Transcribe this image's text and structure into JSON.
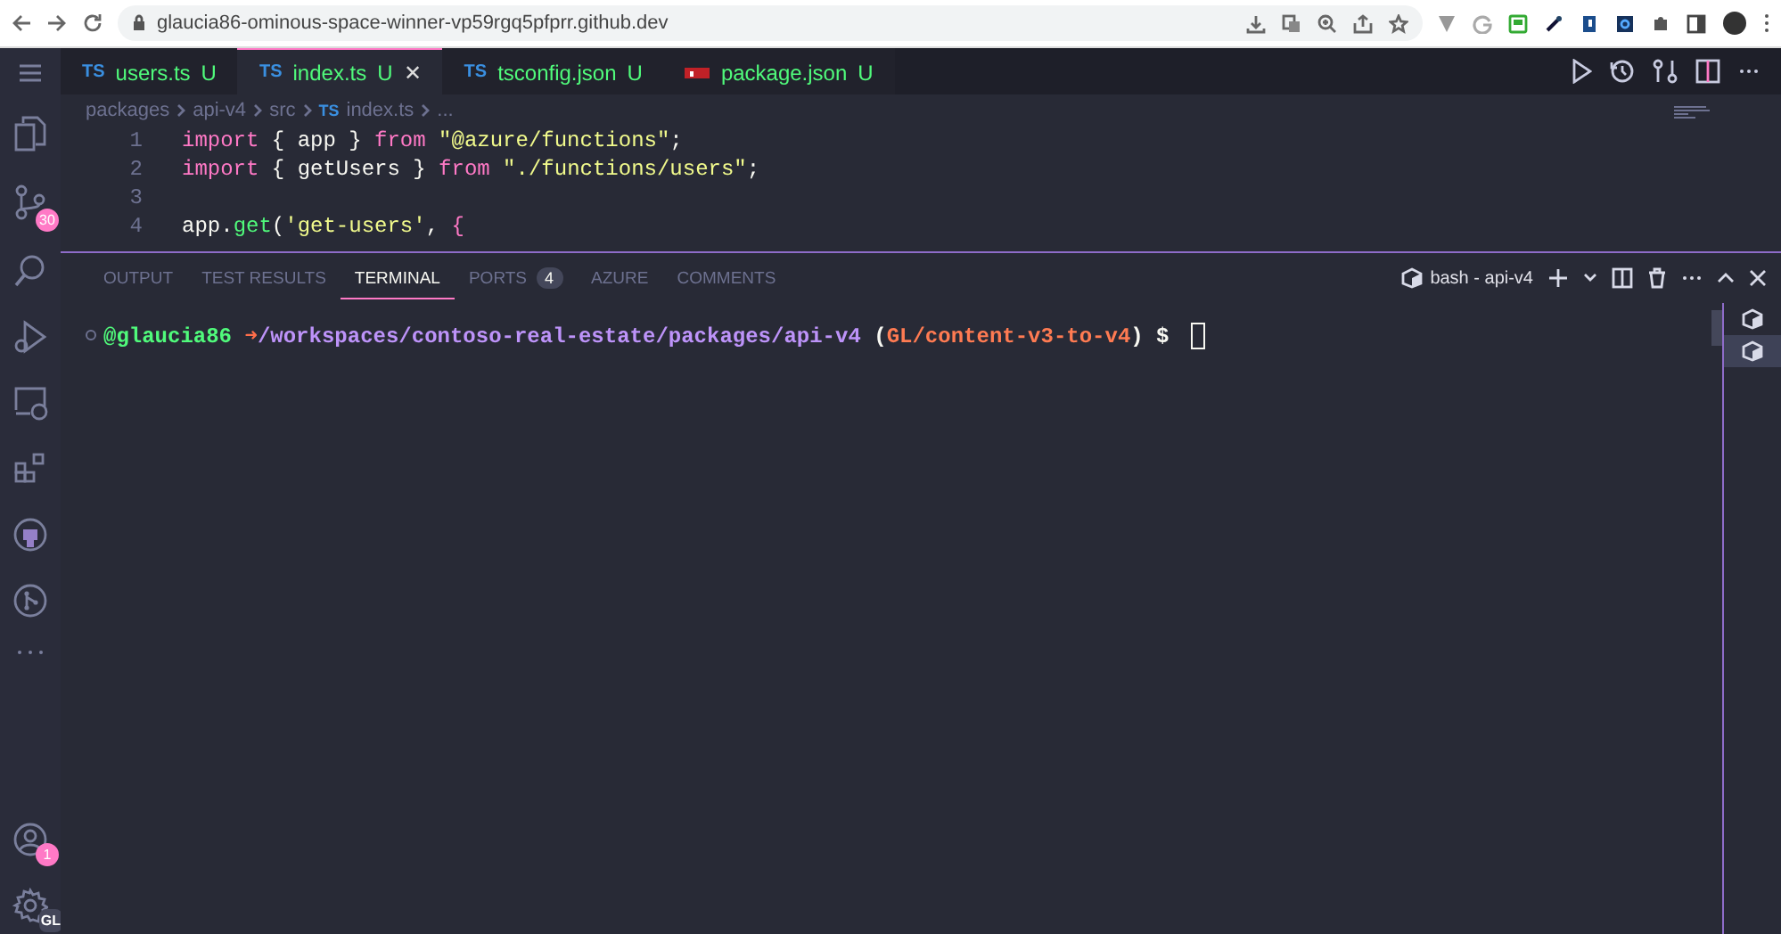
{
  "browser": {
    "url": "glaucia86-ominous-space-winner-vp59rgq5pfprr.github.dev"
  },
  "activity_bar": {
    "source_control_badge": "30",
    "accounts_badge": "1",
    "settings_badge": "GL"
  },
  "editor_tabs": [
    {
      "icon": "TS",
      "kind": "ts",
      "label": "users.ts",
      "status": "U",
      "selected": false
    },
    {
      "icon": "TS",
      "kind": "ts",
      "label": "index.ts",
      "status": "U",
      "selected": true,
      "close": "✕"
    },
    {
      "icon": "TS",
      "kind": "tsconfig",
      "label": "tsconfig.json",
      "status": "U",
      "selected": false
    },
    {
      "kind": "npm",
      "label": "package.json",
      "status": "U",
      "selected": false
    }
  ],
  "breadcrumb": [
    {
      "label": "packages"
    },
    {
      "label": "api-v4"
    },
    {
      "label": "src"
    },
    {
      "label": "index.ts",
      "icon": "TS"
    },
    {
      "label": "..."
    }
  ],
  "code_lines": [
    {
      "number": "1",
      "tokens": [
        {
          "kind": "keyword",
          "text": "import"
        },
        {
          "kind": "plain",
          "text": " { app } "
        },
        {
          "kind": "keyword",
          "text": "from"
        },
        {
          "kind": "string",
          "text": " \"@azure/functions\""
        },
        {
          "kind": "plain",
          "text": ";"
        }
      ]
    },
    {
      "number": "2",
      "tokens": [
        {
          "kind": "keyword",
          "text": "import"
        },
        {
          "kind": "plain",
          "text": " { getUsers } "
        },
        {
          "kind": "keyword",
          "text": "from"
        },
        {
          "kind": "string",
          "text": " \"./functions/users\""
        },
        {
          "kind": "plain",
          "text": ";"
        }
      ]
    },
    {
      "number": "3"
    },
    {
      "number": "4",
      "tokens": [
        {
          "kind": "plain",
          "text": "app."
        },
        {
          "kind": "func",
          "text": "get"
        },
        {
          "kind": "plain",
          "text": "("
        },
        {
          "kind": "string",
          "text": "'get-users'"
        },
        {
          "kind": "plain",
          "text": ", "
        },
        {
          "kind": "keyword",
          "text": "{"
        }
      ]
    }
  ],
  "panel": {
    "tabs": [
      {
        "label": "OUTPUT",
        "selected": false
      },
      {
        "label": "TEST RESULTS",
        "selected": false
      },
      {
        "label": "TERMINAL",
        "selected": true
      },
      {
        "label": "PORTS",
        "selected": false,
        "badge": "4"
      },
      {
        "label": "AZURE",
        "selected": false
      },
      {
        "label": "COMMENTS",
        "selected": false
      }
    ],
    "terminal_name": "bash - api-v4",
    "prompt": [
      {
        "kind": "user",
        "text": "@glaucia86"
      },
      {
        "kind": "arrow",
        "text": " ➜"
      },
      {
        "kind": "path",
        "text": "/workspaces/contoso-real-estate/packages/api-v4"
      },
      {
        "kind": "plain",
        "text": " ("
      },
      {
        "kind": "branch",
        "text": "GL/content-v3-to-v4"
      },
      {
        "kind": "plain",
        "text": ") $ "
      }
    ],
    "terminals": [
      {
        "selected": false
      },
      {
        "selected": true
      }
    ]
  }
}
